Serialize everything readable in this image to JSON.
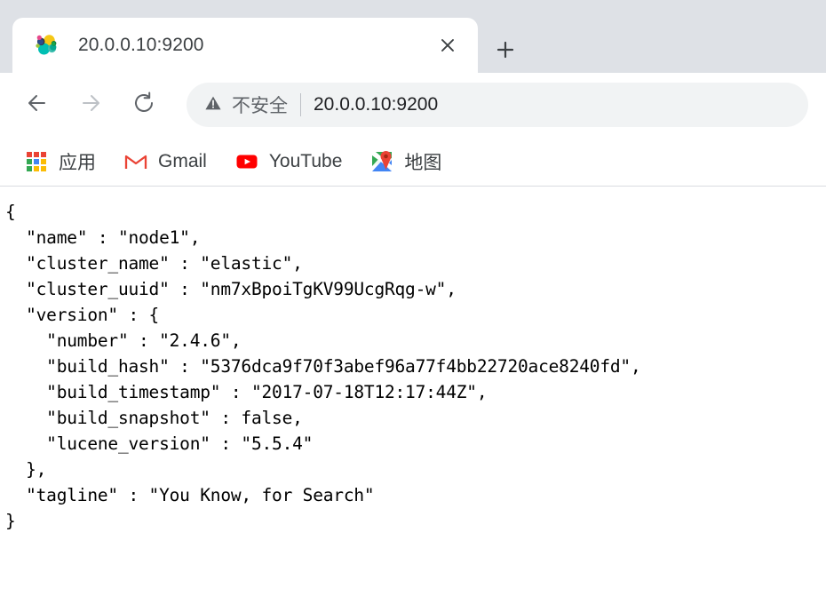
{
  "browser": {
    "tab": {
      "title": "20.0.0.10:9200",
      "favicon": "elasticsearch-favicon",
      "close_icon": "close-icon"
    },
    "new_tab_icon": "plus-icon",
    "toolbar": {
      "back_icon": "back-arrow-icon",
      "forward_icon": "forward-arrow-icon",
      "reload_icon": "reload-icon",
      "omnibox": {
        "warning_icon": "warning-triangle-icon",
        "security_label": "不安全",
        "url": "20.0.0.10:9200"
      }
    },
    "bookmarks": [
      {
        "label": "应用",
        "icon": "apps-grid-icon"
      },
      {
        "label": "Gmail",
        "icon": "gmail-icon"
      },
      {
        "label": "YouTube",
        "icon": "youtube-icon"
      },
      {
        "label": "地图",
        "icon": "google-maps-icon"
      }
    ]
  },
  "page": {
    "content_type": "json-response",
    "json": {
      "name": "node1",
      "cluster_name": "elastic",
      "cluster_uuid": "nm7xBpoiTgKV99UcgRqg-w",
      "version": {
        "number": "2.4.6",
        "build_hash": "5376dca9f70f3abef96a77f4bb22720ace8240fd",
        "build_timestamp": "2017-07-18T12:17:44Z",
        "build_snapshot": "false",
        "lucene_version": "5.5.4"
      },
      "tagline": "You Know, for Search"
    },
    "raw_text": "{\n  \"name\" : \"node1\",\n  \"cluster_name\" : \"elastic\",\n  \"cluster_uuid\" : \"nm7xBpoiTgKV99UcgRqg-w\",\n  \"version\" : {\n    \"number\" : \"2.4.6\",\n    \"build_hash\" : \"5376dca9f70f3abef96a77f4bb22720ace8240fd\",\n    \"build_timestamp\" : \"2017-07-18T12:17:44Z\",\n    \"build_snapshot\" : false,\n    \"lucene_version\" : \"5.5.4\"\n  },\n  \"tagline\" : \"You Know, for Search\"\n}"
  },
  "colors": {
    "tabstrip_bg": "#dee1e6",
    "omnibox_bg": "#f1f3f4",
    "text_primary": "#202124",
    "text_secondary": "#5f6368",
    "gmail_red": "#ea4335",
    "youtube_red": "#ff0000"
  }
}
